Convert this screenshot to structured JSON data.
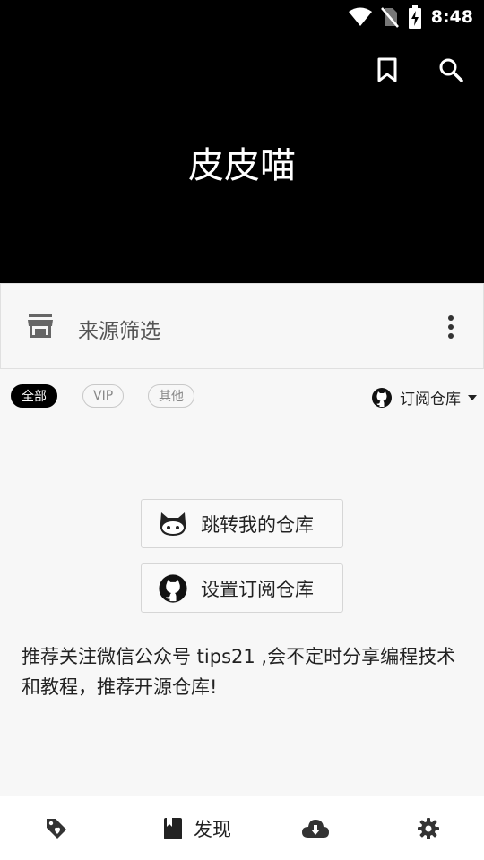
{
  "status_bar": {
    "time": "8:48"
  },
  "header": {
    "title": "皮皮喵"
  },
  "filter": {
    "label": "来源筛选"
  },
  "chips": [
    {
      "label": "全部",
      "active": true
    },
    {
      "label": "VIP",
      "active": false
    },
    {
      "label": "其他",
      "active": false
    }
  ],
  "subscribe": {
    "label": "订阅仓库"
  },
  "buttons": {
    "jump": "跳转我的仓库",
    "settings": "设置订阅仓库"
  },
  "notice": "推荐关注微信公众号 tips21 ,会不定时分享编程技术和教程，推荐开源仓库!",
  "bottom_nav": {
    "discover_label": "发现"
  },
  "colors": {
    "header_bg": "#000000",
    "accent": "#000000"
  }
}
